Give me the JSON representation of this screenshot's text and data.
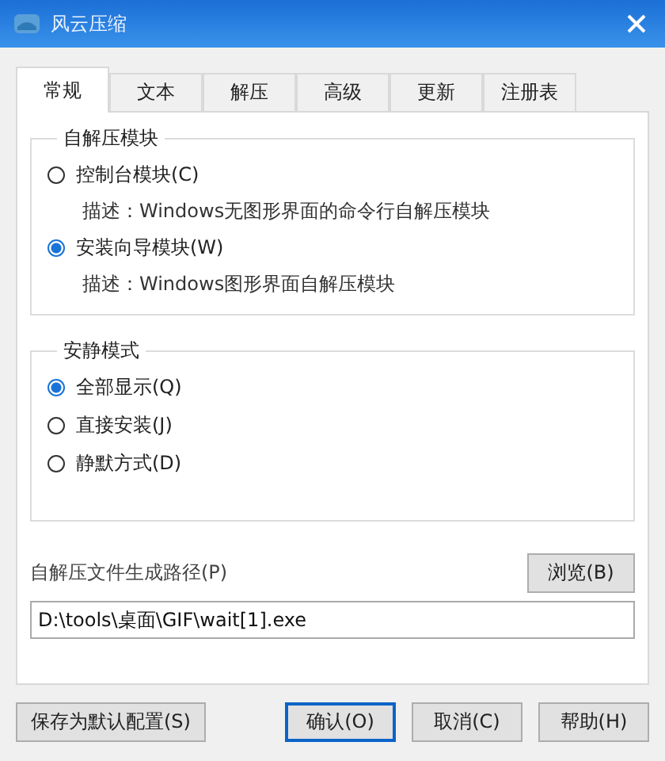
{
  "window": {
    "title": "风云压缩"
  },
  "tabs": [
    {
      "label": "常规",
      "selected": true
    },
    {
      "label": "文本",
      "selected": false
    },
    {
      "label": "解压",
      "selected": false
    },
    {
      "label": "高级",
      "selected": false
    },
    {
      "label": "更新",
      "selected": false
    },
    {
      "label": "注册表",
      "selected": false
    }
  ],
  "module_group": {
    "title": "自解压模块",
    "options": [
      {
        "label": "控制台模块(C)",
        "selected": false,
        "description": "描述：Windows无图形界面的命令行自解压模块"
      },
      {
        "label": "安装向导模块(W)",
        "selected": true,
        "description": "描述：Windows图形界面自解压模块"
      }
    ]
  },
  "mode_group": {
    "title": "安静模式",
    "options": [
      {
        "label": "全部显示(Q)",
        "selected": true
      },
      {
        "label": "直接安装(J)",
        "selected": false
      },
      {
        "label": "静默方式(D)",
        "selected": false
      }
    ]
  },
  "output_path": {
    "label": "自解压文件生成路径(P)",
    "browse_button": "浏览(B)",
    "value": "D:\\tools\\桌面\\GIF\\wait[1].exe"
  },
  "buttons": {
    "save_default": "保存为默认配置(S)",
    "ok": "确认(O)",
    "cancel": "取消(C)",
    "help": "帮助(H)"
  }
}
